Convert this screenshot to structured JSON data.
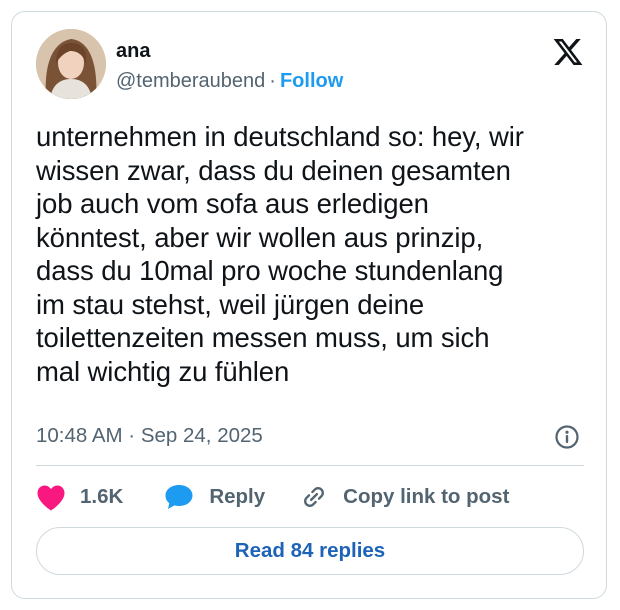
{
  "author": {
    "name": "ana",
    "handle": "@temberaubend",
    "separator": "·",
    "follow_label": "Follow"
  },
  "brand_icon": "x-logo-icon",
  "tweet": {
    "text": "unternehmen in deutschland so: hey, wir\nwissen zwar, dass du deinen gesamten\njob auch vom sofa aus erledigen\nkönntest, aber wir wollen aus prinzip,\ndass du 10mal pro woche stundenlang\nim stau stehst, weil jürgen deine\ntoilettenzeiten messen muss, um sich\nmal wichtig zu fühlen",
    "timestamp": "10:48 AM · Sep 24, 2025"
  },
  "actions": {
    "like_count": "1.6K",
    "reply_label": "Reply",
    "copy_link_label": "Copy link to post"
  },
  "read_replies_label": "Read 84 replies",
  "colors": {
    "accent": "#1d9bf0",
    "like": "#f91880",
    "reply_bubble": "#1d9bf0",
    "read_replies": "#1d63b8",
    "secondary_text": "#536471",
    "border": "#cfd9de"
  }
}
